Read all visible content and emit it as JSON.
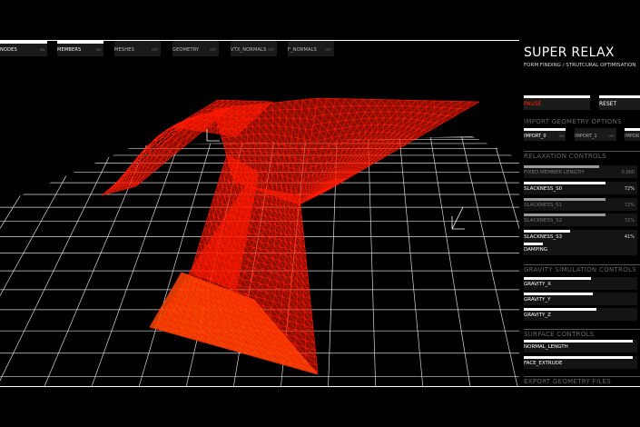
{
  "top_toggles": [
    {
      "label": "NODES",
      "state": "ON"
    },
    {
      "label": "MEMBERS",
      "state": "ON"
    },
    {
      "label": "MESHES",
      "state": "OFF"
    },
    {
      "label": "GEOMETRY",
      "state": "OFF"
    },
    {
      "label": "VTX_NORMALS",
      "state": "OFF"
    },
    {
      "label": "F_NORMALS",
      "state": "OFF"
    }
  ],
  "app": {
    "title": "SUPER RELAX",
    "subtitle": "FORM FINDING / STRUTCURAL OPTIMISATION"
  },
  "controls": {
    "pause_label": "PAUSE",
    "reset_label": "RESET"
  },
  "import": {
    "heading": "IMPORT GEOMETRY OPTIONS",
    "options": [
      {
        "label": "IMPORT_0",
        "state": "ON"
      },
      {
        "label": "IMPORT_1",
        "state": "OFF"
      },
      {
        "label": "IMPOR",
        "state": ""
      }
    ]
  },
  "relaxation": {
    "heading": "RELAXATION CONTROLS",
    "sliders": [
      {
        "label": "FIXED MEMBER LENGTH",
        "value": "0.000",
        "fill": 0.66
      },
      {
        "label": "SLACKNESS_S0",
        "value": "72%",
        "fill": 0.72
      },
      {
        "label": "SLACKNESS_S1",
        "value": "72%",
        "fill": 0.72
      },
      {
        "label": "SLACKNESS_S2",
        "value": "72%",
        "fill": 0.72
      },
      {
        "label": "SLACKNESS_S3",
        "value": "41%",
        "fill": 0.41
      },
      {
        "label": "DAMPING",
        "value": "",
        "fill": 0.17
      }
    ]
  },
  "gravity": {
    "heading": "GRAVITY SIMULATION CONTROLS",
    "sliders": [
      {
        "label": "GRAVITY_X",
        "value": "",
        "fill": 0.59
      },
      {
        "label": "GRAVITY_Y",
        "value": "",
        "fill": 0.61
      },
      {
        "label": "GRAVITY_Z",
        "value": "",
        "fill": 0.64
      }
    ]
  },
  "surface": {
    "heading": "SURFACE CONTROLS",
    "sliders": [
      {
        "label": "NORMAL_LENGTH",
        "value": "",
        "fill": 0.96
      },
      {
        "label": "FACE_EXTRUDE",
        "value": "",
        "fill": 0.96
      }
    ]
  },
  "export": {
    "heading": "EXPORT GEOMETRY FILES"
  },
  "colors": {
    "mesh": "#ff1a00",
    "mesh_highlight": "#ffcc00",
    "grid": "#d8d8d8",
    "background": "#000000"
  }
}
